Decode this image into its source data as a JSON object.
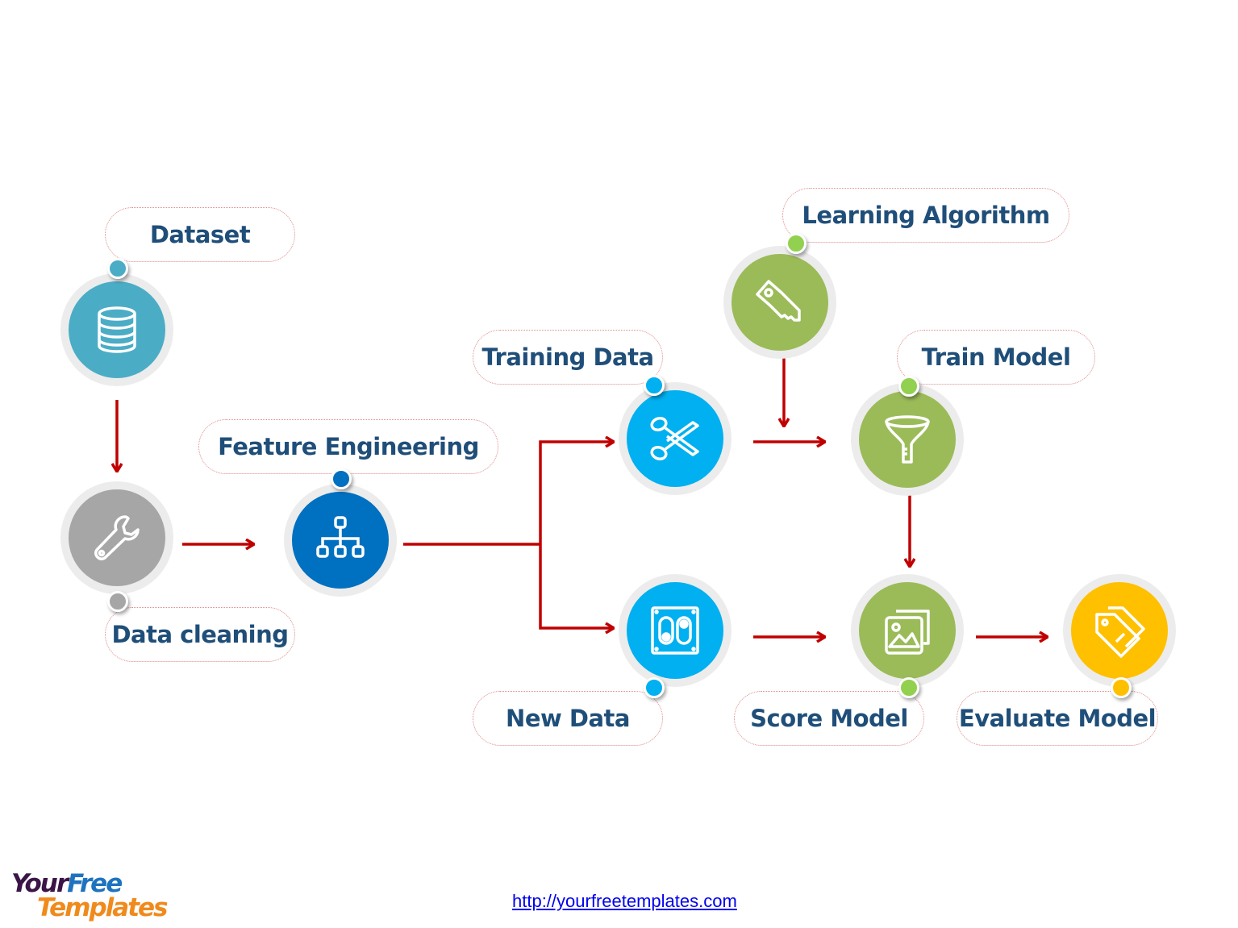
{
  "diagram": {
    "nodes": [
      {
        "id": "dataset",
        "label": "Dataset",
        "icon": "database-icon",
        "color": "#4bacc6"
      },
      {
        "id": "data-cleaning",
        "label": "Data cleaning",
        "icon": "wrench-icon",
        "color": "#a6a6a6"
      },
      {
        "id": "feature-engineering",
        "label": "Feature Engineering",
        "icon": "hierarchy-icon",
        "color": "#0070c0"
      },
      {
        "id": "training-data",
        "label": "Training Data",
        "icon": "scissors-icon",
        "color": "#00b0f0"
      },
      {
        "id": "new-data",
        "label": "New Data",
        "icon": "switch-panel-icon",
        "color": "#00b0f0"
      },
      {
        "id": "learning-algorithm",
        "label": "Learning Algorithm",
        "icon": "key-icon",
        "color": "#9bbb59"
      },
      {
        "id": "train-model",
        "label": "Train Model",
        "icon": "funnel-icon",
        "color": "#9bbb59"
      },
      {
        "id": "score-model",
        "label": "Score Model",
        "icon": "images-icon",
        "color": "#9bbb59"
      },
      {
        "id": "evaluate-model",
        "label": "Evaluate Model",
        "icon": "tags-icon",
        "color": "#ffc000"
      }
    ],
    "edges": [
      {
        "from": "dataset",
        "to": "data-cleaning"
      },
      {
        "from": "data-cleaning",
        "to": "feature-engineering"
      },
      {
        "from": "feature-engineering",
        "to": "training-data"
      },
      {
        "from": "feature-engineering",
        "to": "new-data"
      },
      {
        "from": "learning-algorithm",
        "to": "train-model"
      },
      {
        "from": "training-data",
        "to": "train-model"
      },
      {
        "from": "train-model",
        "to": "score-model"
      },
      {
        "from": "new-data",
        "to": "score-model"
      },
      {
        "from": "score-model",
        "to": "evaluate-model"
      }
    ],
    "dot_colors": {
      "dataset": "#4bacc6",
      "data-cleaning": "#a6a6a6",
      "feature-engineering": "#0070c0",
      "training-data": "#00b0f0",
      "new-data": "#00b0f0",
      "learning-algorithm": "#92d050",
      "train-model": "#92d050",
      "score-model": "#92d050",
      "evaluate-model": "#ffc000"
    },
    "arrow_color": "#c00000",
    "label_text_color": "#1f4e79"
  },
  "footer": {
    "logo_line1_a": "Your",
    "logo_line1_b": "Free",
    "logo_line2": "Templates",
    "url": "http://yourfreetemplates.com"
  }
}
